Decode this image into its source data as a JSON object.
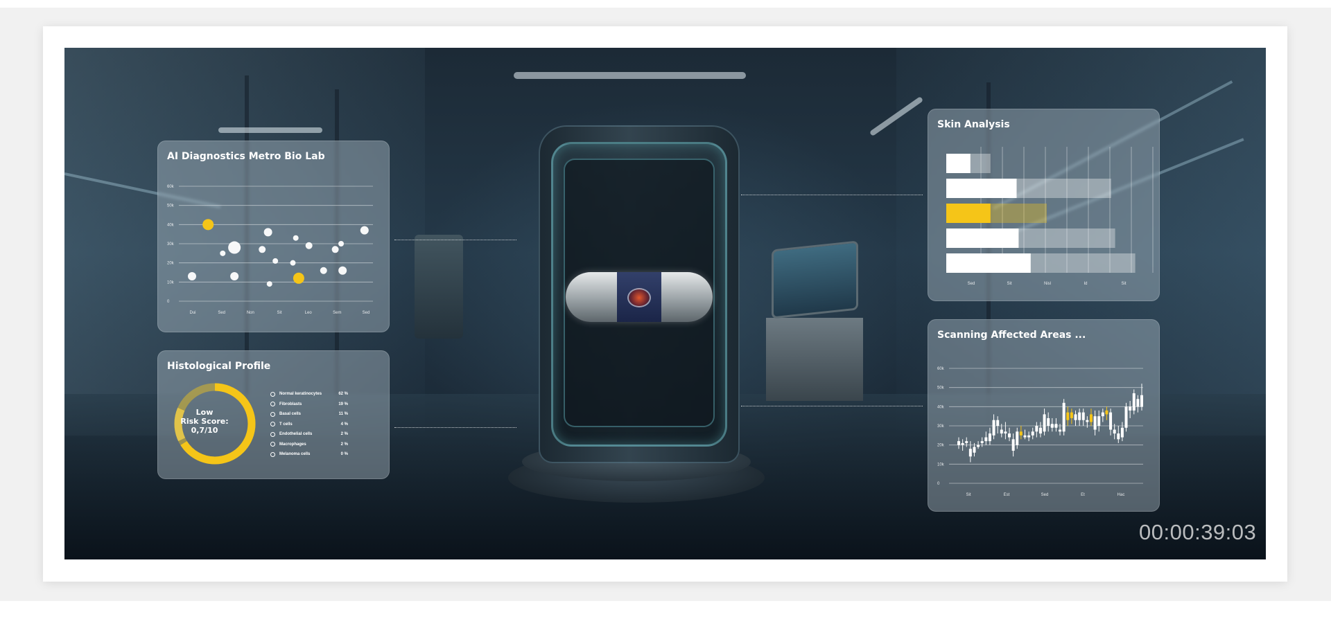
{
  "colors": {
    "accent": "#f5c518",
    "panel_text": "#ffffff"
  },
  "timecode": "00:00:39:03",
  "panels": {
    "diagnostics": {
      "title": "AI Diagnostics Metro Bio Lab",
      "chart_data": {
        "type": "scatter",
        "y_ticks": [
          "60k",
          "50k",
          "40k",
          "30k",
          "20k",
          "10k",
          "0"
        ],
        "x_ticks": [
          "Dui",
          "Sed",
          "Non",
          "Sit",
          "Leo",
          "Sem",
          "Sed"
        ],
        "ylim": [
          0,
          60000
        ],
        "xlim": [
          0,
          6
        ],
        "grid": true,
        "points": [
          {
            "x": 0.55,
            "y": 40000,
            "r": 8,
            "color": "#f5c518"
          },
          {
            "x": 0.0,
            "y": 13000,
            "r": 6,
            "color": "#ffffff"
          },
          {
            "x": 1.05,
            "y": 25000,
            "r": 4,
            "color": "#ffffff"
          },
          {
            "x": 1.45,
            "y": 28000,
            "r": 9,
            "color": "#ffffff"
          },
          {
            "x": 1.45,
            "y": 13000,
            "r": 6,
            "color": "#ffffff"
          },
          {
            "x": 2.4,
            "y": 27000,
            "r": 5,
            "color": "#ffffff"
          },
          {
            "x": 2.6,
            "y": 36000,
            "r": 6,
            "color": "#ffffff"
          },
          {
            "x": 2.65,
            "y": 9000,
            "r": 4,
            "color": "#ffffff"
          },
          {
            "x": 2.85,
            "y": 21000,
            "r": 4,
            "color": "#ffffff"
          },
          {
            "x": 3.45,
            "y": 20000,
            "r": 4,
            "color": "#ffffff"
          },
          {
            "x": 3.55,
            "y": 33000,
            "r": 4,
            "color": "#ffffff"
          },
          {
            "x": 3.65,
            "y": 12000,
            "r": 8,
            "color": "#f5c518"
          },
          {
            "x": 4.0,
            "y": 29000,
            "r": 5,
            "color": "#ffffff"
          },
          {
            "x": 4.5,
            "y": 16000,
            "r": 5,
            "color": "#ffffff"
          },
          {
            "x": 4.9,
            "y": 27000,
            "r": 5,
            "color": "#ffffff"
          },
          {
            "x": 5.1,
            "y": 30000,
            "r": 4,
            "color": "#ffffff"
          },
          {
            "x": 5.15,
            "y": 16000,
            "r": 6,
            "color": "#ffffff"
          },
          {
            "x": 5.9,
            "y": 37000,
            "r": 6,
            "color": "#ffffff"
          }
        ]
      }
    },
    "histology": {
      "title": "Histological Profile",
      "risk_line1": "Low",
      "risk_line2": "Risk Score:",
      "risk_line3": "0,7/10",
      "risk_fraction": 0.07,
      "cells": [
        {
          "label": "Normal keratinocytes",
          "value": "62 %"
        },
        {
          "label": "Fibroblasts",
          "value": "19 %"
        },
        {
          "label": "Basal cells",
          "value": "11 %"
        },
        {
          "label": "T cells",
          "value": "4 %"
        },
        {
          "label": "Endothelial cells",
          "value": "2 %"
        },
        {
          "label": "Macrophages",
          "value": "2 %"
        },
        {
          "label": "Melanoma cells",
          "value": "0 %"
        }
      ]
    },
    "skin": {
      "title": "Skin Analysis",
      "chart_data": {
        "type": "bar",
        "orientation": "horizontal",
        "x_ticks": [
          "Sed",
          "Sit",
          "Nisl",
          "Id",
          "Sit"
        ],
        "bars": [
          {
            "solid": 0.12,
            "fade": 0.22,
            "color": "#ffffff"
          },
          {
            "solid": 0.35,
            "fade": 0.82,
            "color": "#ffffff"
          },
          {
            "solid": 0.22,
            "fade": 0.5,
            "color": "#f5c518"
          },
          {
            "solid": 0.36,
            "fade": 0.84,
            "color": "#ffffff"
          },
          {
            "solid": 0.42,
            "fade": 0.94,
            "color": "#ffffff"
          }
        ]
      }
    },
    "scanning": {
      "title": "Scanning Affected Areas ...",
      "chart_data": {
        "type": "candlestick",
        "y_ticks": [
          "60k",
          "50k",
          "40k",
          "30k",
          "20k",
          "10k",
          "0"
        ],
        "x_ticks": [
          "Sit",
          "Est",
          "Sed",
          "Et",
          "Hac"
        ],
        "ylim": [
          0,
          60000
        ],
        "candles": [
          [
            20,
            22,
            18,
            24,
            "w"
          ],
          [
            21,
            20,
            17,
            23,
            "w"
          ],
          [
            22,
            21,
            19,
            24,
            "w"
          ],
          [
            18,
            14,
            11,
            22,
            "w"
          ],
          [
            16,
            19,
            14,
            21,
            "w"
          ],
          [
            19,
            20,
            18,
            22,
            "w"
          ],
          [
            21,
            22,
            19,
            24,
            "w"
          ],
          [
            24,
            22,
            20,
            27,
            "w"
          ],
          [
            22,
            26,
            20,
            29,
            "w"
          ],
          [
            25,
            33,
            23,
            36,
            "w"
          ],
          [
            33,
            30,
            26,
            35,
            "w"
          ],
          [
            28,
            26,
            24,
            31,
            "w"
          ],
          [
            27,
            26,
            23,
            32,
            "w"
          ],
          [
            26,
            24,
            22,
            29,
            "w"
          ],
          [
            23,
            17,
            14,
            26,
            "w"
          ],
          [
            20,
            27,
            18,
            29,
            "w"
          ],
          [
            27,
            25,
            23,
            30,
            "y"
          ],
          [
            25,
            24,
            23,
            28,
            "w"
          ],
          [
            24,
            25,
            22,
            27,
            "w"
          ],
          [
            25,
            27,
            23,
            29,
            "w"
          ],
          [
            27,
            30,
            24,
            32,
            "w"
          ],
          [
            29,
            26,
            24,
            32,
            "w"
          ],
          [
            27,
            36,
            25,
            39,
            "w"
          ],
          [
            34,
            30,
            27,
            37,
            "w"
          ],
          [
            29,
            31,
            27,
            34,
            "w"
          ],
          [
            31,
            29,
            27,
            34,
            "w"
          ],
          [
            28,
            27,
            25,
            31,
            "w"
          ],
          [
            27,
            42,
            25,
            44,
            "w"
          ],
          [
            37,
            33,
            30,
            40,
            "y"
          ],
          [
            34,
            37,
            31,
            39,
            "y"
          ],
          [
            36,
            33,
            30,
            38,
            "w"
          ],
          [
            33,
            37,
            30,
            39,
            "w"
          ],
          [
            37,
            33,
            30,
            39,
            "w"
          ],
          [
            33,
            32,
            29,
            35,
            "w"
          ],
          [
            32,
            36,
            30,
            39,
            "y"
          ],
          [
            35,
            28,
            25,
            38,
            "w"
          ],
          [
            30,
            35,
            27,
            38,
            "w"
          ],
          [
            35,
            37,
            32,
            39,
            "w"
          ],
          [
            36,
            38,
            33,
            40,
            "y"
          ],
          [
            37,
            28,
            25,
            39,
            "w"
          ],
          [
            28,
            26,
            23,
            31,
            "w"
          ],
          [
            26,
            23,
            21,
            30,
            "w"
          ],
          [
            24,
            29,
            22,
            32,
            "w"
          ],
          [
            29,
            40,
            27,
            42,
            "w"
          ],
          [
            40,
            38,
            34,
            43,
            "w"
          ],
          [
            38,
            47,
            36,
            49,
            "w"
          ],
          [
            44,
            40,
            37,
            46,
            "w"
          ],
          [
            40,
            46,
            38,
            52,
            "w"
          ]
        ]
      }
    }
  }
}
